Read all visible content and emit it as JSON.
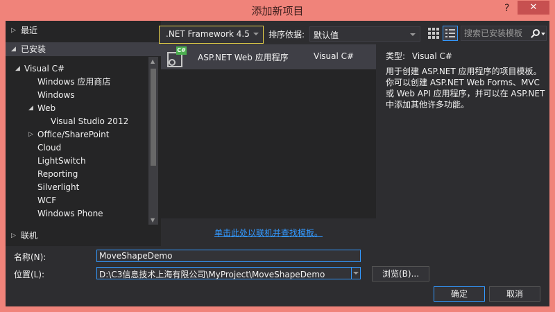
{
  "window": {
    "title": "添加新项目",
    "help": "?",
    "close": "✕"
  },
  "left": {
    "recent": "最近",
    "installed": "已安装",
    "online": "联机",
    "tree": [
      {
        "label": "Visual C#",
        "level": 0,
        "arrow": "◢"
      },
      {
        "label": "Windows 应用商店",
        "level": 1
      },
      {
        "label": "Windows",
        "level": 1
      },
      {
        "label": "Web",
        "level": 1,
        "arrow": "◢",
        "selected": true
      },
      {
        "label": "Visual Studio 2012",
        "level": 2
      },
      {
        "label": "Office/SharePoint",
        "level": 1,
        "arrow": "▷"
      },
      {
        "label": "Cloud",
        "level": 1
      },
      {
        "label": "LightSwitch",
        "level": 1
      },
      {
        "label": "Reporting",
        "level": 1
      },
      {
        "label": "Silverlight",
        "level": 1
      },
      {
        "label": "WCF",
        "level": 1
      },
      {
        "label": "Windows Phone",
        "level": 1
      }
    ]
  },
  "toolbar": {
    "framework": ".NET Framework 4.5",
    "sort_label": "排序依据:",
    "sort_value": "默认值",
    "search_placeholder": "搜索已安装模板"
  },
  "templates": [
    {
      "name": "ASP.NET Web 应用程序",
      "lang": "Visual C#",
      "badge": "C#"
    }
  ],
  "online_link": "单击此处以联机并查找模板。",
  "description": {
    "type_label": "类型:",
    "type_value": "Visual C#",
    "text": "用于创建 ASP.NET 应用程序的项目模板。你可以创建 ASP.NET Web Forms、MVC 或 Web API 应用程序，并可以在 ASP.NET 中添加其他许多功能。"
  },
  "form": {
    "name_label": "名称(N):",
    "name_value": "MoveShapeDemo",
    "location_label": "位置(L):",
    "location_value": "D:\\C3信息技术上海有限公司\\MyProject\\MoveShapeDemo",
    "browse": "浏览(B)...",
    "ok": "确定",
    "cancel": "取消"
  },
  "colors": {
    "frame": "#f0837a",
    "body": "#2d2d30",
    "accent": "#3399ff",
    "framework_border": "#e8d34a"
  }
}
